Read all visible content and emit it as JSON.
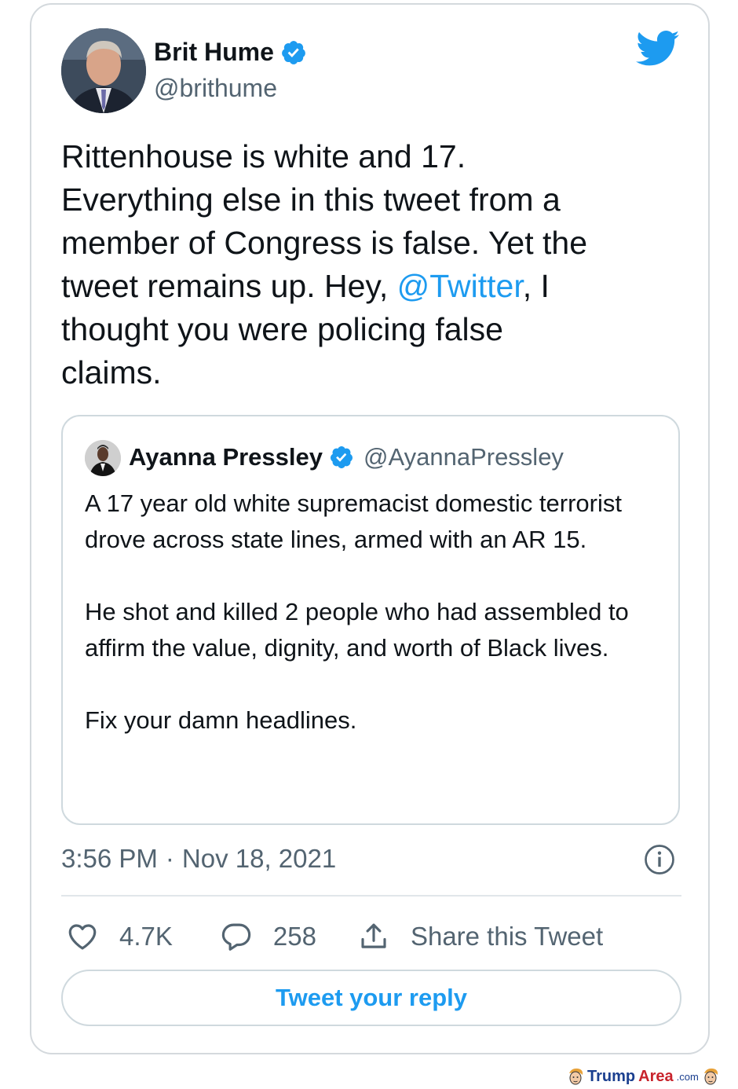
{
  "tweet": {
    "author": {
      "name": "Brit Hume",
      "handle": "@brithume",
      "verified": true
    },
    "text_before": "Rittenhouse is white and 17.\nEverything else in this tweet from a\nmember of Congress is false. Yet the\ntweet remains up. Hey, ",
    "mention": "@Twitter",
    "text_after": ", I\nthought you were policing false\nclaims.",
    "timestamp_time": "3:56 PM",
    "timestamp_sep": "·",
    "timestamp_date": "Nov 18, 2021",
    "likes": "4.7K",
    "replies": "258",
    "share_label": "Share this Tweet",
    "reply_button": "Tweet your reply"
  },
  "quoted": {
    "name": "Ayanna Pressley",
    "handle": "@AyannaPressley",
    "verified": true,
    "paragraphs": [
      "A 17 year old white supremacist domestic terrorist drove across state lines, armed with an AR 15.",
      "He shot and killed 2 people who had assembled to affirm the value, dignity, and worth of Black lives.",
      "Fix your damn headlines."
    ]
  },
  "watermark": {
    "trump": "Trump",
    "area": "Area",
    "com": ".com"
  },
  "colors": {
    "accent": "#1d9bf0",
    "text": "#0f1419",
    "muted": "#536471",
    "border": "#cfd9de"
  },
  "icons": [
    "twitter-bird-icon",
    "verified-badge-icon",
    "info-icon",
    "heart-icon",
    "reply-bubble-icon",
    "share-icon"
  ]
}
